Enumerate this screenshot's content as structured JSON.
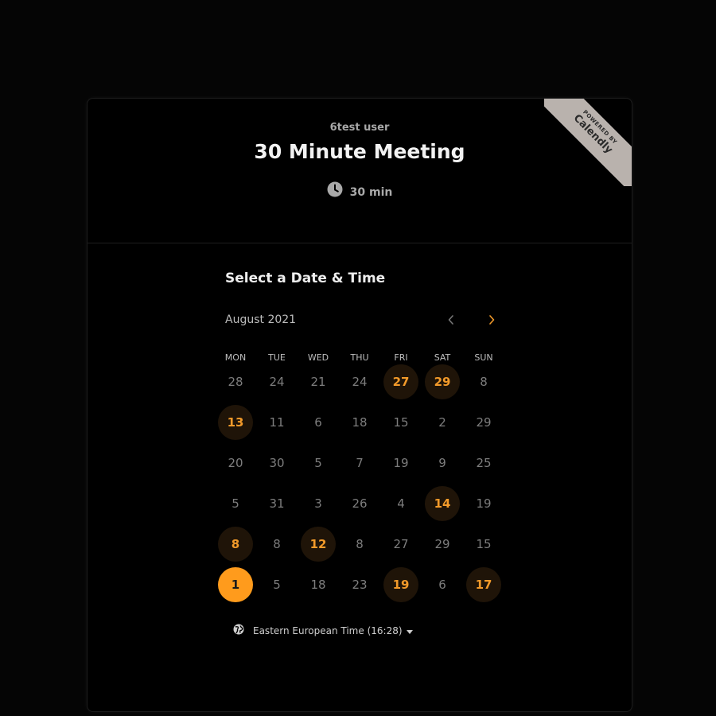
{
  "ribbon": {
    "powered_by": "POWERED BY",
    "brand": "Calendly"
  },
  "header": {
    "owner": "6test user",
    "title": "30 Minute Meeting",
    "duration": "30 min",
    "duration_icon": "clock-icon"
  },
  "scheduler": {
    "section_title": "Select a Date & Time",
    "month_label": "August 2021",
    "prev_icon": "chevron-left-icon",
    "next_icon": "chevron-right-icon",
    "weekdays": [
      "MON",
      "TUE",
      "WED",
      "THU",
      "FRI",
      "SAT",
      "SUN"
    ],
    "weeks": [
      [
        {
          "day": "28",
          "state": "unavailable"
        },
        {
          "day": "24",
          "state": "unavailable"
        },
        {
          "day": "21",
          "state": "unavailable"
        },
        {
          "day": "24",
          "state": "unavailable"
        },
        {
          "day": "27",
          "state": "available"
        },
        {
          "day": "29",
          "state": "available"
        },
        {
          "day": "8",
          "state": "unavailable"
        }
      ],
      [
        {
          "day": "13",
          "state": "available"
        },
        {
          "day": "11",
          "state": "unavailable"
        },
        {
          "day": "6",
          "state": "unavailable"
        },
        {
          "day": "18",
          "state": "unavailable"
        },
        {
          "day": "15",
          "state": "unavailable"
        },
        {
          "day": "2",
          "state": "unavailable"
        },
        {
          "day": "29",
          "state": "unavailable"
        }
      ],
      [
        {
          "day": "20",
          "state": "unavailable"
        },
        {
          "day": "30",
          "state": "unavailable"
        },
        {
          "day": "5",
          "state": "unavailable"
        },
        {
          "day": "7",
          "state": "unavailable"
        },
        {
          "day": "19",
          "state": "unavailable"
        },
        {
          "day": "9",
          "state": "unavailable"
        },
        {
          "day": "25",
          "state": "unavailable"
        }
      ],
      [
        {
          "day": "5",
          "state": "unavailable"
        },
        {
          "day": "31",
          "state": "unavailable"
        },
        {
          "day": "3",
          "state": "unavailable"
        },
        {
          "day": "26",
          "state": "unavailable"
        },
        {
          "day": "4",
          "state": "unavailable"
        },
        {
          "day": "14",
          "state": "available"
        },
        {
          "day": "19",
          "state": "unavailable"
        }
      ],
      [
        {
          "day": "8",
          "state": "available"
        },
        {
          "day": "8",
          "state": "unavailable"
        },
        {
          "day": "12",
          "state": "available"
        },
        {
          "day": "8",
          "state": "unavailable"
        },
        {
          "day": "27",
          "state": "unavailable"
        },
        {
          "day": "29",
          "state": "unavailable"
        },
        {
          "day": "15",
          "state": "unavailable"
        }
      ],
      [
        {
          "day": "1",
          "state": "selected"
        },
        {
          "day": "5",
          "state": "unavailable"
        },
        {
          "day": "18",
          "state": "unavailable"
        },
        {
          "day": "23",
          "state": "unavailable"
        },
        {
          "day": "19",
          "state": "available"
        },
        {
          "day": "6",
          "state": "unavailable"
        },
        {
          "day": "17",
          "state": "available"
        }
      ]
    ],
    "timezone": {
      "label": "Eastern European Time (16:28)",
      "icon": "globe-icon",
      "dropdown_icon": "caret-down-icon"
    }
  },
  "colors": {
    "accent": "#ff9b1c",
    "available_text": "#f29a2a",
    "available_bg": "#1f1408",
    "unavailable_text": "#7d7d7d",
    "card_bg": "#000000",
    "ribbon_bg": "#b9b2ad"
  }
}
